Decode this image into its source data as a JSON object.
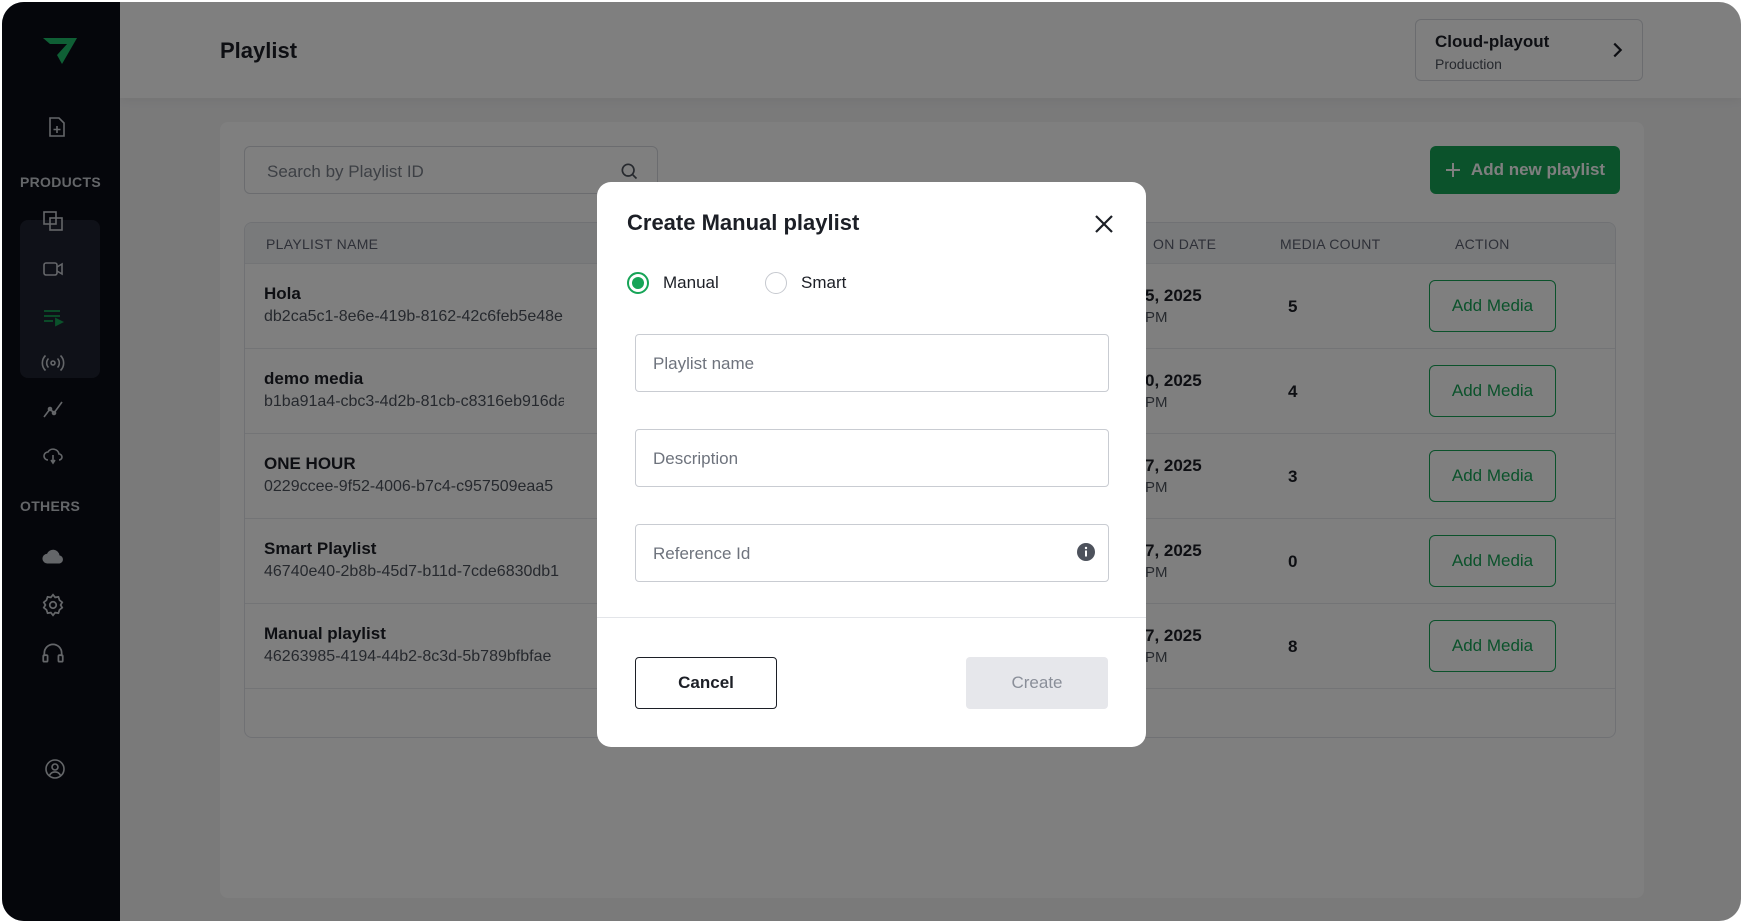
{
  "page": {
    "title": "Playlist"
  },
  "environment": {
    "name": "Cloud-playout",
    "stage": "Production"
  },
  "sidebar": {
    "products_label": "PRODUCTS",
    "others_label": "OTHERS",
    "accent_color": "#16a457"
  },
  "search": {
    "placeholder": "Search by Playlist ID"
  },
  "add_button": {
    "label": "Add new playlist"
  },
  "table": {
    "columns": {
      "name": "PLAYLIST NAME",
      "date": "ON DATE",
      "count": "MEDIA COUNT",
      "action": "ACTION"
    },
    "rows": [
      {
        "name": "Hola",
        "id": "db2ca5c1-8e6e-419b-8162-42c6feb5e48e",
        "date": "5, 2025",
        "time": "PM",
        "count": "5",
        "action": "Add Media"
      },
      {
        "name": "demo media",
        "id": "b1ba91a4-cbc3-4d2b-81cb-c8316eb916da",
        "date": "0, 2025",
        "time": "PM",
        "count": "4",
        "action": "Add Media"
      },
      {
        "name": "ONE HOUR",
        "id": "0229ccee-9f52-4006-b7c4-c957509eaa5",
        "date": "7, 2025",
        "time": "PM",
        "count": "3",
        "action": "Add Media"
      },
      {
        "name": "Smart Playlist",
        "id": "46740e40-2b8b-45d7-b11d-7cde6830db1",
        "date": "7, 2025",
        "time": "PM",
        "count": "0",
        "action": "Add Media"
      },
      {
        "name": "Manual playlist",
        "id": "46263985-4194-44b2-8c3d-5b789bfbfae",
        "date": "7, 2025",
        "time": "PM",
        "count": "8",
        "action": "Add Media"
      }
    ]
  },
  "modal": {
    "title": "Create Manual playlist",
    "type_options": [
      {
        "label": "Manual",
        "selected": true
      },
      {
        "label": "Smart",
        "selected": false
      }
    ],
    "fields": {
      "name_placeholder": "Playlist name",
      "description_placeholder": "Description",
      "reference_placeholder": "Reference Id"
    },
    "cancel_label": "Cancel",
    "create_label": "Create"
  }
}
